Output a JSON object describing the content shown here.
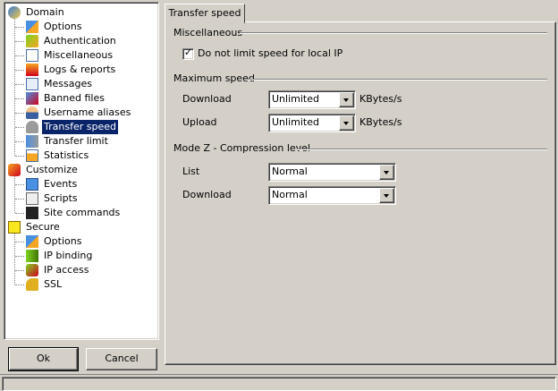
{
  "tree": {
    "groups": [
      {
        "label": "Domain",
        "icon": "domain-icon",
        "items": [
          {
            "label": "Options",
            "icon": "options-icon"
          },
          {
            "label": "Authentication",
            "icon": "authentication-icon"
          },
          {
            "label": "Miscellaneous",
            "icon": "miscellaneous-icon"
          },
          {
            "label": "Logs & reports",
            "icon": "logs-icon"
          },
          {
            "label": "Messages",
            "icon": "messages-icon"
          },
          {
            "label": "Banned files",
            "icon": "banned-files-icon"
          },
          {
            "label": "Username aliases",
            "icon": "username-aliases-icon"
          },
          {
            "label": "Transfer speed",
            "icon": "transfer-speed-icon",
            "selected": true
          },
          {
            "label": "Transfer limit",
            "icon": "transfer-limit-icon"
          },
          {
            "label": "Statistics",
            "icon": "statistics-icon"
          }
        ]
      },
      {
        "label": "Customize",
        "icon": "customize-icon",
        "items": [
          {
            "label": "Events",
            "icon": "events-icon"
          },
          {
            "label": "Scripts",
            "icon": "scripts-icon"
          },
          {
            "label": "Site commands",
            "icon": "site-commands-icon"
          }
        ]
      },
      {
        "label": "Secure",
        "icon": "secure-icon",
        "items": [
          {
            "label": "Options",
            "icon": "secure-options-icon"
          },
          {
            "label": "IP binding",
            "icon": "ip-binding-icon"
          },
          {
            "label": "IP access",
            "icon": "ip-access-icon"
          },
          {
            "label": "SSL",
            "icon": "ssl-key-icon"
          }
        ]
      }
    ]
  },
  "buttons": {
    "ok": "Ok",
    "cancel": "Cancel"
  },
  "tab": {
    "label": "Transfer speed"
  },
  "misc": {
    "heading": "Miscellaneous",
    "checkbox_label": "Do not limit speed for local IP",
    "checked": true
  },
  "max_speed": {
    "heading": "Maximum speed",
    "download_label": "Download",
    "download_value": "Unlimited",
    "upload_label": "Upload",
    "upload_value": "Unlimited",
    "unit": "KBytes/s"
  },
  "modez": {
    "heading": "Mode Z - Compression level",
    "list_label": "List",
    "list_value": "Normal",
    "download_label": "Download",
    "download_value": "Normal"
  }
}
